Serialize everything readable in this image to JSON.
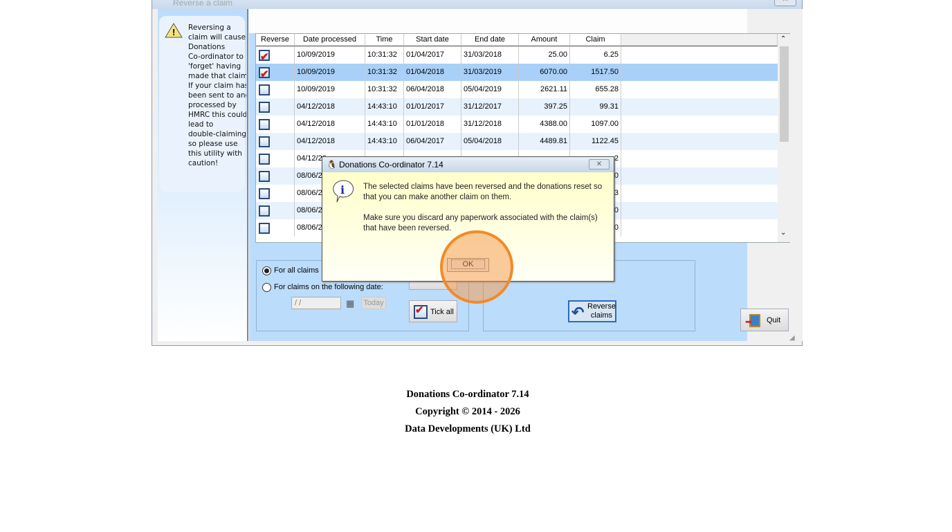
{
  "window": {
    "title": "Reverse a claim",
    "close": "✕"
  },
  "warning": {
    "text": "Reversing a\nclaim will cause\nDonations\nCo-ordinator to\n'forget' having\nmade that claim.\nIf your claim has\nbeen sent to and\nprocessed by\nHMRC this could\nlead to\ndouble-claiming,\nso please use\nthis utility with\ncaution!"
  },
  "table": {
    "headers": [
      "Reverse",
      "Date processed",
      "Time",
      "Start date",
      "End date",
      "Amount",
      "Claim"
    ],
    "rows": [
      {
        "checked": true,
        "date": "10/09/2019",
        "time": "10:31:32",
        "start": "01/04/2017",
        "end": "31/03/2018",
        "amount": "25.00",
        "claim": "6.25"
      },
      {
        "checked": true,
        "date": "10/09/2019",
        "time": "10:31:32",
        "start": "01/04/2018",
        "end": "31/03/2019",
        "amount": "6070.00",
        "claim": "1517.50",
        "selected": true
      },
      {
        "checked": false,
        "date": "10/09/2019",
        "time": "10:31:32",
        "start": "06/04/2018",
        "end": "05/04/2019",
        "amount": "2621.11",
        "claim": "655.28"
      },
      {
        "checked": false,
        "date": "04/12/2018",
        "time": "14:43:10",
        "start": "01/01/2017",
        "end": "31/12/2017",
        "amount": "397.25",
        "claim": "99.31"
      },
      {
        "checked": false,
        "date": "04/12/2018",
        "time": "14:43:10",
        "start": "01/01/2018",
        "end": "31/12/2018",
        "amount": "4388.00",
        "claim": "1097.00"
      },
      {
        "checked": false,
        "date": "04/12/2018",
        "time": "14:43:10",
        "start": "06/04/2017",
        "end": "05/04/2018",
        "amount": "4489.81",
        "claim": "1122.45"
      },
      {
        "checked": false,
        "date": "04/12/20",
        "time": "",
        "start": "",
        "end": "",
        "amount": "",
        "claim": "2"
      },
      {
        "checked": false,
        "date": "08/06/20",
        "time": "",
        "start": "",
        "end": "",
        "amount": "",
        "claim": "0"
      },
      {
        "checked": false,
        "date": "08/06/20",
        "time": "",
        "start": "",
        "end": "",
        "amount": "",
        "claim": "3"
      },
      {
        "checked": false,
        "date": "08/06/20",
        "time": "",
        "start": "",
        "end": "",
        "amount": "",
        "claim": "0"
      },
      {
        "checked": false,
        "date": "08/06/20",
        "time": "",
        "start": "",
        "end": "",
        "amount": "",
        "claim": "0"
      }
    ]
  },
  "filters": {
    "all_claims": "For all claims",
    "on_date": "For claims on the following date:",
    "date_value": " / /",
    "today": "Today"
  },
  "buttons": {
    "tick_all": "Tick all",
    "reverse_claims_1": "Reverse",
    "reverse_claims_2": "claims",
    "quit": "Quit"
  },
  "dialog": {
    "title": "Donations Co-ordinator 7.14",
    "close": "✕",
    "line1": "The selected claims have been reversed and the donations reset so that you can make another claim on them.",
    "line2": "Make sure you discard any paperwork associated with the claim(s) that have been reversed.",
    "ok": "OK"
  },
  "footer": {
    "line1": "Donations Co-ordinator 7.14",
    "line2": "Copyright © 2014 - 2026",
    "line3": "Data Developments (UK) Ltd"
  }
}
